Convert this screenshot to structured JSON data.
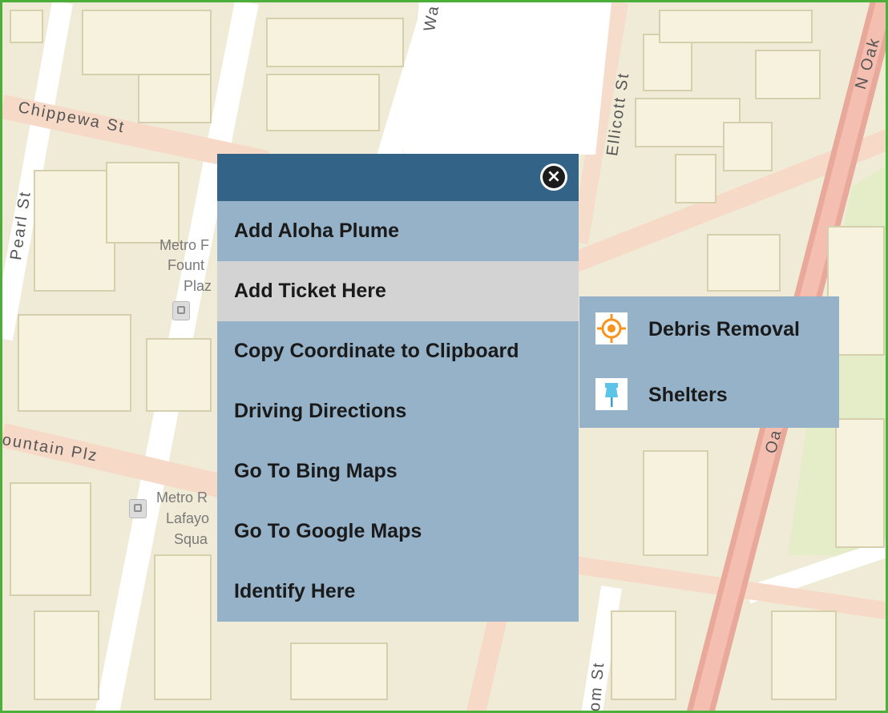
{
  "map": {
    "streets": {
      "chippewa": "Chippewa St",
      "ellicott": "Ellicott St",
      "oak_top": "N Oak",
      "oak_side": "Oa",
      "pearl": "Pearl St",
      "fountain": "ountain Plz",
      "washington": "Wa",
      "bottom": "om St"
    },
    "poi": {
      "fountain_plaza": [
        "Metro F",
        "Fount",
        "Plaz"
      ],
      "lafayette_square": [
        "Metro R",
        "Lafayo",
        "Squa"
      ]
    },
    "icons": {
      "transit": "transit-station-icon"
    }
  },
  "context_menu": {
    "close_icon": "close-circle-icon",
    "items": [
      {
        "label": "Add Aloha Plume"
      },
      {
        "label": "Add Ticket Here",
        "highlighted": true
      },
      {
        "label": "Copy Coordinate to Clipboard"
      },
      {
        "label": "Driving Directions"
      },
      {
        "label": "Go To Bing Maps"
      },
      {
        "label": "Go To Google Maps"
      },
      {
        "label": "Identify Here"
      }
    ]
  },
  "submenu": {
    "items": [
      {
        "label": "Debris Removal",
        "icon": "debris-target-icon"
      },
      {
        "label": "Shelters",
        "icon": "pushpin-icon"
      }
    ]
  },
  "colors": {
    "menu_header": "#336488",
    "menu_bg": "#96b2c9",
    "menu_highlight": "#d3d3d3",
    "frame_border": "#4caf3a",
    "debris_icon": "#f7941d",
    "shelter_icon": "#5bc4e8"
  }
}
